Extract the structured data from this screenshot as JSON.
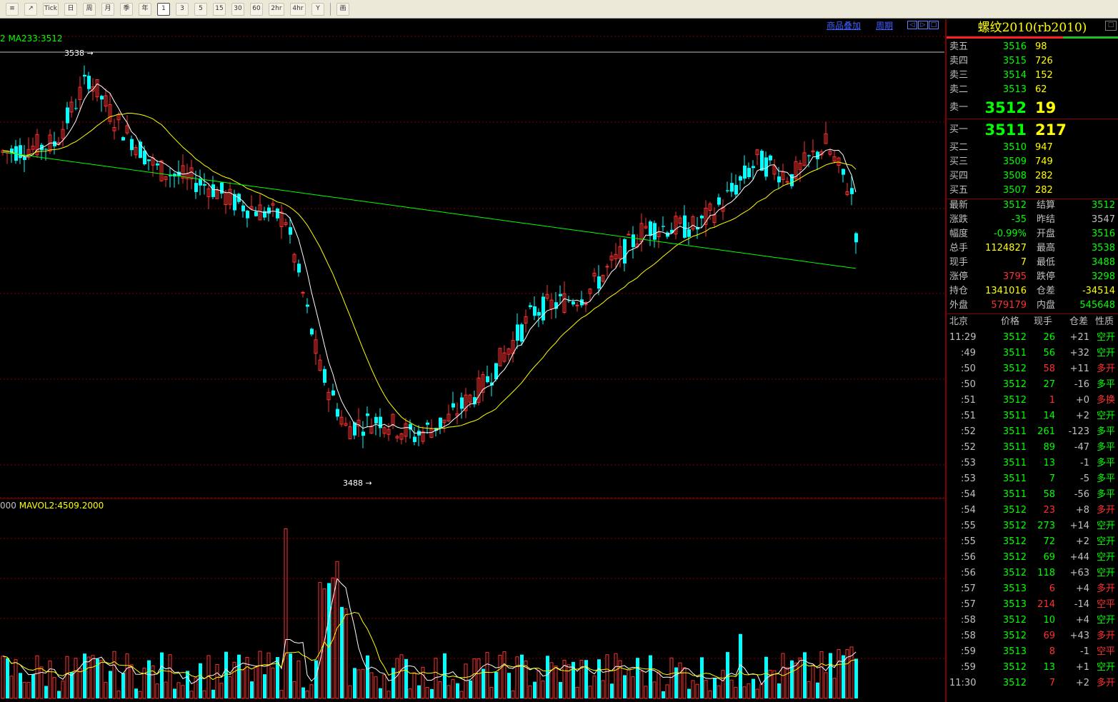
{
  "toolbar": {
    "buttons": [
      "≡",
      "↗",
      "Tick",
      "日",
      "周",
      "月",
      "季",
      "年",
      "1",
      "3",
      "5",
      "15",
      "30",
      "60",
      "2hr",
      "4hr",
      "Y",
      "画"
    ],
    "selected": "1"
  },
  "chart": {
    "ma_label": "2 MA233:3512",
    "high_marker": "3538",
    "low_marker": "3488",
    "vol_label_prefix": "000",
    "vol_label": "MAVOL2:4509.2000",
    "overlay_link": "商品叠加",
    "period_link": "周期",
    "nav": [
      "◁",
      "▷",
      "□"
    ]
  },
  "panel": {
    "title": "螺纹2010(rb2010)",
    "win_btn": "□",
    "asks": [
      {
        "label": "卖五",
        "price": "3516",
        "vol": "98"
      },
      {
        "label": "卖四",
        "price": "3515",
        "vol": "726"
      },
      {
        "label": "卖三",
        "price": "3514",
        "vol": "152"
      },
      {
        "label": "卖二",
        "price": "3513",
        "vol": "62"
      }
    ],
    "ask1": {
      "label": "卖一",
      "price": "3512",
      "vol": "19"
    },
    "bid1": {
      "label": "买一",
      "price": "3511",
      "vol": "217"
    },
    "bids": [
      {
        "label": "买二",
        "price": "3510",
        "vol": "947"
      },
      {
        "label": "买三",
        "price": "3509",
        "vol": "749"
      },
      {
        "label": "买四",
        "price": "3508",
        "vol": "282"
      },
      {
        "label": "买五",
        "price": "3507",
        "vol": "282"
      }
    ],
    "stats": [
      {
        "l1": "最新",
        "v1": "3512",
        "c1": "g",
        "l2": "结算",
        "v2": "3512",
        "c2": "g"
      },
      {
        "l1": "涨跌",
        "v1": "-35",
        "c1": "g",
        "l2": "昨结",
        "v2": "3547",
        "c2": "w"
      },
      {
        "l1": "幅度",
        "v1": "-0.99%",
        "c1": "g",
        "l2": "开盘",
        "v2": "3516",
        "c2": "g"
      },
      {
        "l1": "总手",
        "v1": "1124827",
        "c1": "y",
        "l2": "最高",
        "v2": "3538",
        "c2": "g"
      },
      {
        "l1": "现手",
        "v1": "7",
        "c1": "y",
        "l2": "最低",
        "v2": "3488",
        "c2": "g"
      },
      {
        "l1": "涨停",
        "v1": "3795",
        "c1": "r",
        "l2": "跌停",
        "v2": "3298",
        "c2": "g"
      },
      {
        "l1": "持仓",
        "v1": "1341016",
        "c1": "y",
        "l2": "仓差",
        "v2": "-34514",
        "c2": "y"
      },
      {
        "l1": "外盘",
        "v1": "579179",
        "c1": "r",
        "l2": "内盘",
        "v2": "545648",
        "c2": "g"
      }
    ],
    "tick_header": {
      "time": "北京",
      "price": "价格",
      "vol": "现手",
      "oi": "仓差",
      "nature": "性质"
    },
    "ticks": [
      {
        "time": "11:29",
        "price": "3512",
        "pc": "g",
        "vol": "26",
        "vc": "g",
        "oi": "+21",
        "nature": "空开",
        "nc": "g"
      },
      {
        "time": ":49",
        "price": "3511",
        "pc": "g",
        "vol": "56",
        "vc": "g",
        "oi": "+32",
        "nature": "空开",
        "nc": "g"
      },
      {
        "time": ":50",
        "price": "3512",
        "pc": "g",
        "vol": "58",
        "vc": "r",
        "oi": "+11",
        "nature": "多开",
        "nc": "r"
      },
      {
        "time": ":50",
        "price": "3512",
        "pc": "g",
        "vol": "27",
        "vc": "g",
        "oi": "-16",
        "nature": "多平",
        "nc": "g"
      },
      {
        "time": ":51",
        "price": "3512",
        "pc": "g",
        "vol": "1",
        "vc": "r",
        "oi": "+0",
        "nature": "多换",
        "nc": "r"
      },
      {
        "time": ":51",
        "price": "3511",
        "pc": "g",
        "vol": "14",
        "vc": "g",
        "oi": "+2",
        "nature": "空开",
        "nc": "g"
      },
      {
        "time": ":52",
        "price": "3511",
        "pc": "g",
        "vol": "261",
        "vc": "g",
        "oi": "-123",
        "nature": "多平",
        "nc": "g"
      },
      {
        "time": ":52",
        "price": "3511",
        "pc": "g",
        "vol": "89",
        "vc": "g",
        "oi": "-47",
        "nature": "多平",
        "nc": "g"
      },
      {
        "time": ":53",
        "price": "3511",
        "pc": "g",
        "vol": "13",
        "vc": "g",
        "oi": "-1",
        "nature": "多平",
        "nc": "g"
      },
      {
        "time": ":53",
        "price": "3511",
        "pc": "g",
        "vol": "7",
        "vc": "g",
        "oi": "-5",
        "nature": "多平",
        "nc": "g"
      },
      {
        "time": ":54",
        "price": "3511",
        "pc": "g",
        "vol": "58",
        "vc": "g",
        "oi": "-56",
        "nature": "多平",
        "nc": "g"
      },
      {
        "time": ":54",
        "price": "3512",
        "pc": "g",
        "vol": "23",
        "vc": "r",
        "oi": "+8",
        "nature": "多开",
        "nc": "r"
      },
      {
        "time": ":55",
        "price": "3512",
        "pc": "g",
        "vol": "273",
        "vc": "g",
        "oi": "+14",
        "nature": "空开",
        "nc": "g"
      },
      {
        "time": ":55",
        "price": "3512",
        "pc": "g",
        "vol": "72",
        "vc": "g",
        "oi": "+2",
        "nature": "空开",
        "nc": "g"
      },
      {
        "time": ":56",
        "price": "3512",
        "pc": "g",
        "vol": "69",
        "vc": "g",
        "oi": "+44",
        "nature": "空开",
        "nc": "g"
      },
      {
        "time": ":56",
        "price": "3512",
        "pc": "g",
        "vol": "118",
        "vc": "g",
        "oi": "+63",
        "nature": "空开",
        "nc": "g"
      },
      {
        "time": ":57",
        "price": "3513",
        "pc": "g",
        "vol": "6",
        "vc": "r",
        "oi": "+4",
        "nature": "多开",
        "nc": "r"
      },
      {
        "time": ":57",
        "price": "3513",
        "pc": "g",
        "vol": "214",
        "vc": "r",
        "oi": "-14",
        "nature": "空平",
        "nc": "r"
      },
      {
        "time": ":58",
        "price": "3512",
        "pc": "g",
        "vol": "10",
        "vc": "g",
        "oi": "+4",
        "nature": "空开",
        "nc": "g"
      },
      {
        "time": ":58",
        "price": "3512",
        "pc": "g",
        "vol": "69",
        "vc": "r",
        "oi": "+43",
        "nature": "多开",
        "nc": "r"
      },
      {
        "time": ":59",
        "price": "3513",
        "pc": "g",
        "vol": "8",
        "vc": "r",
        "oi": "-1",
        "nature": "空平",
        "nc": "r"
      },
      {
        "time": ":59",
        "price": "3512",
        "pc": "g",
        "vol": "13",
        "vc": "g",
        "oi": "+1",
        "nature": "空开",
        "nc": "g"
      },
      {
        "time": "11:30",
        "price": "3512",
        "pc": "g",
        "vol": "7",
        "vc": "r",
        "oi": "+2",
        "nature": "多开",
        "nc": "r"
      }
    ]
  },
  "colors": {
    "up": "#ff3030",
    "down": "#00ffff",
    "ma_short": "#ffffff",
    "ma_mid": "#ffff00",
    "ma_long": "#00ff00",
    "grid": "#800000"
  }
}
